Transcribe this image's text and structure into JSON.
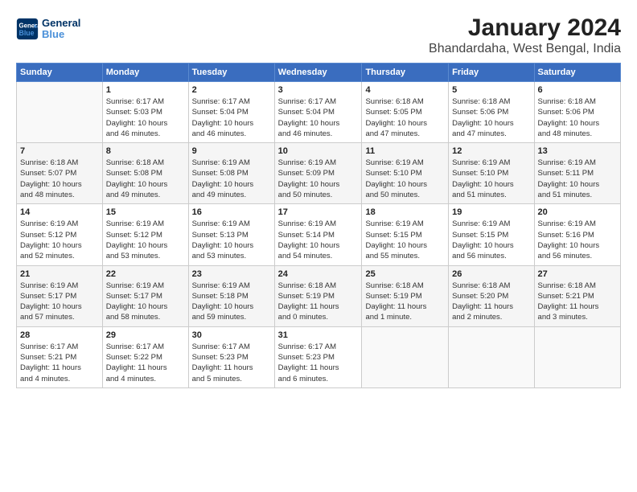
{
  "header": {
    "logo_line1": "General",
    "logo_line2": "Blue",
    "title": "January 2024",
    "subtitle": "Bhandardaha, West Bengal, India"
  },
  "days_of_week": [
    "Sunday",
    "Monday",
    "Tuesday",
    "Wednesday",
    "Thursday",
    "Friday",
    "Saturday"
  ],
  "weeks": [
    [
      {
        "day": "",
        "info": ""
      },
      {
        "day": "1",
        "info": "Sunrise: 6:17 AM\nSunset: 5:03 PM\nDaylight: 10 hours\nand 46 minutes."
      },
      {
        "day": "2",
        "info": "Sunrise: 6:17 AM\nSunset: 5:04 PM\nDaylight: 10 hours\nand 46 minutes."
      },
      {
        "day": "3",
        "info": "Sunrise: 6:17 AM\nSunset: 5:04 PM\nDaylight: 10 hours\nand 46 minutes."
      },
      {
        "day": "4",
        "info": "Sunrise: 6:18 AM\nSunset: 5:05 PM\nDaylight: 10 hours\nand 47 minutes."
      },
      {
        "day": "5",
        "info": "Sunrise: 6:18 AM\nSunset: 5:06 PM\nDaylight: 10 hours\nand 47 minutes."
      },
      {
        "day": "6",
        "info": "Sunrise: 6:18 AM\nSunset: 5:06 PM\nDaylight: 10 hours\nand 48 minutes."
      }
    ],
    [
      {
        "day": "7",
        "info": "Sunrise: 6:18 AM\nSunset: 5:07 PM\nDaylight: 10 hours\nand 48 minutes."
      },
      {
        "day": "8",
        "info": "Sunrise: 6:18 AM\nSunset: 5:08 PM\nDaylight: 10 hours\nand 49 minutes."
      },
      {
        "day": "9",
        "info": "Sunrise: 6:19 AM\nSunset: 5:08 PM\nDaylight: 10 hours\nand 49 minutes."
      },
      {
        "day": "10",
        "info": "Sunrise: 6:19 AM\nSunset: 5:09 PM\nDaylight: 10 hours\nand 50 minutes."
      },
      {
        "day": "11",
        "info": "Sunrise: 6:19 AM\nSunset: 5:10 PM\nDaylight: 10 hours\nand 50 minutes."
      },
      {
        "day": "12",
        "info": "Sunrise: 6:19 AM\nSunset: 5:10 PM\nDaylight: 10 hours\nand 51 minutes."
      },
      {
        "day": "13",
        "info": "Sunrise: 6:19 AM\nSunset: 5:11 PM\nDaylight: 10 hours\nand 51 minutes."
      }
    ],
    [
      {
        "day": "14",
        "info": "Sunrise: 6:19 AM\nSunset: 5:12 PM\nDaylight: 10 hours\nand 52 minutes."
      },
      {
        "day": "15",
        "info": "Sunrise: 6:19 AM\nSunset: 5:12 PM\nDaylight: 10 hours\nand 53 minutes."
      },
      {
        "day": "16",
        "info": "Sunrise: 6:19 AM\nSunset: 5:13 PM\nDaylight: 10 hours\nand 53 minutes."
      },
      {
        "day": "17",
        "info": "Sunrise: 6:19 AM\nSunset: 5:14 PM\nDaylight: 10 hours\nand 54 minutes."
      },
      {
        "day": "18",
        "info": "Sunrise: 6:19 AM\nSunset: 5:15 PM\nDaylight: 10 hours\nand 55 minutes."
      },
      {
        "day": "19",
        "info": "Sunrise: 6:19 AM\nSunset: 5:15 PM\nDaylight: 10 hours\nand 56 minutes."
      },
      {
        "day": "20",
        "info": "Sunrise: 6:19 AM\nSunset: 5:16 PM\nDaylight: 10 hours\nand 56 minutes."
      }
    ],
    [
      {
        "day": "21",
        "info": "Sunrise: 6:19 AM\nSunset: 5:17 PM\nDaylight: 10 hours\nand 57 minutes."
      },
      {
        "day": "22",
        "info": "Sunrise: 6:19 AM\nSunset: 5:17 PM\nDaylight: 10 hours\nand 58 minutes."
      },
      {
        "day": "23",
        "info": "Sunrise: 6:19 AM\nSunset: 5:18 PM\nDaylight: 10 hours\nand 59 minutes."
      },
      {
        "day": "24",
        "info": "Sunrise: 6:18 AM\nSunset: 5:19 PM\nDaylight: 11 hours\nand 0 minutes."
      },
      {
        "day": "25",
        "info": "Sunrise: 6:18 AM\nSunset: 5:19 PM\nDaylight: 11 hours\nand 1 minute."
      },
      {
        "day": "26",
        "info": "Sunrise: 6:18 AM\nSunset: 5:20 PM\nDaylight: 11 hours\nand 2 minutes."
      },
      {
        "day": "27",
        "info": "Sunrise: 6:18 AM\nSunset: 5:21 PM\nDaylight: 11 hours\nand 3 minutes."
      }
    ],
    [
      {
        "day": "28",
        "info": "Sunrise: 6:17 AM\nSunset: 5:21 PM\nDaylight: 11 hours\nand 4 minutes."
      },
      {
        "day": "29",
        "info": "Sunrise: 6:17 AM\nSunset: 5:22 PM\nDaylight: 11 hours\nand 4 minutes."
      },
      {
        "day": "30",
        "info": "Sunrise: 6:17 AM\nSunset: 5:23 PM\nDaylight: 11 hours\nand 5 minutes."
      },
      {
        "day": "31",
        "info": "Sunrise: 6:17 AM\nSunset: 5:23 PM\nDaylight: 11 hours\nand 6 minutes."
      },
      {
        "day": "",
        "info": ""
      },
      {
        "day": "",
        "info": ""
      },
      {
        "day": "",
        "info": ""
      }
    ]
  ]
}
